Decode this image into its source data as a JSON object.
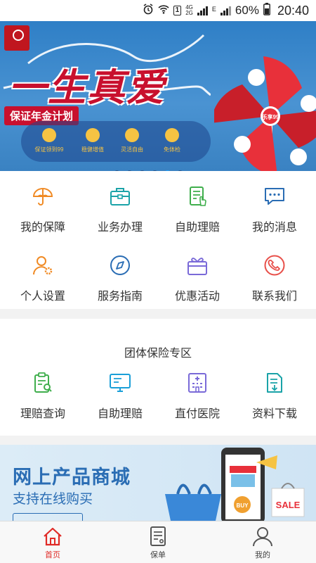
{
  "status_bar": {
    "net_top": "4G",
    "net_bottom": "2G",
    "sim": "1",
    "net_e": "E",
    "battery": "60%",
    "time": "20:40"
  },
  "banner": {
    "headline": "一生真爱",
    "subtitle": "保证年金计划",
    "features": [
      {
        "label": "保证领到99",
        "icon": "elder-icon"
      },
      {
        "label": "稳健增值",
        "icon": "coin-icon"
      },
      {
        "label": "灵活自由",
        "icon": "plant-icon"
      },
      {
        "label": "免体检",
        "icon": "stethoscope-icon"
      }
    ],
    "badge": "乐享99",
    "dots_total": 6,
    "dots_active": 5
  },
  "services": [
    {
      "label": "我的保障",
      "icon": "umbrella-icon"
    },
    {
      "label": "业务办理",
      "icon": "briefcase-icon"
    },
    {
      "label": "自助理赔",
      "icon": "document-hand-icon"
    },
    {
      "label": "我的消息",
      "icon": "chat-icon"
    },
    {
      "label": "个人设置",
      "icon": "user-settings-icon"
    },
    {
      "label": "服务指南",
      "icon": "compass-icon"
    },
    {
      "label": "优惠活动",
      "icon": "gift-icon"
    },
    {
      "label": "联系我们",
      "icon": "phone-icon"
    }
  ],
  "group": {
    "title": "团体保险专区",
    "items": [
      {
        "label": "理赔查询",
        "icon": "clipboard-search-icon"
      },
      {
        "label": "自助理赔",
        "icon": "monitor-icon"
      },
      {
        "label": "直付医院",
        "icon": "hospital-icon"
      },
      {
        "label": "资料下载",
        "icon": "download-doc-icon"
      }
    ]
  },
  "promo": {
    "title": "网上产品商城",
    "subtitle": "支持在线购买",
    "sale": "SALE",
    "buy": "BUY"
  },
  "tabbar": [
    {
      "label": "首页",
      "icon": "home-icon",
      "active": true
    },
    {
      "label": "保单",
      "icon": "policy-icon",
      "active": false
    },
    {
      "label": "我的",
      "icon": "profile-icon",
      "active": false
    }
  ],
  "colors": {
    "brand_red": "#e02b27",
    "banner_blue": "#3a88cc",
    "orange": "#f08a24",
    "teal": "#1aa3a8",
    "green": "#3fae4c",
    "blue": "#2a6db4",
    "purple": "#7a6ad8"
  }
}
